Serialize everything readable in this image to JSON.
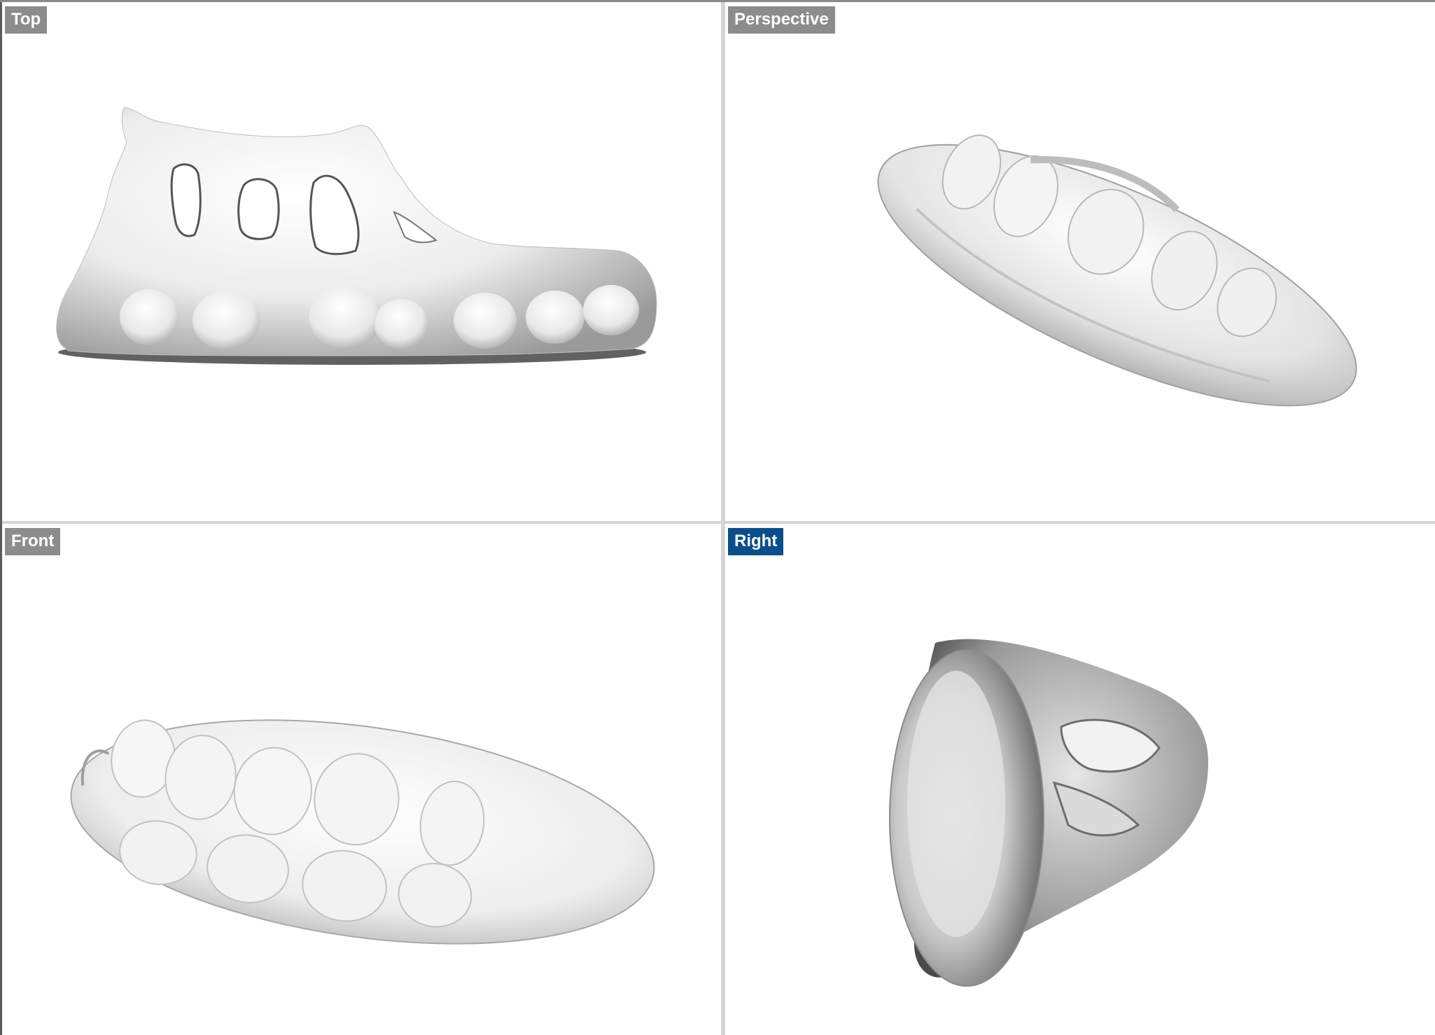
{
  "colors": {
    "label_bg": "#8c8c8c",
    "label_active_bg": "#0b4e8c",
    "viewport_bg": "#ffffff",
    "separator": "#d4d4d4"
  },
  "viewports": [
    {
      "id": "top",
      "label": "Top",
      "active": false
    },
    {
      "id": "perspective",
      "label": "Perspective",
      "active": false
    },
    {
      "id": "front",
      "label": "Front",
      "active": false
    },
    {
      "id": "right",
      "label": "Right",
      "active": true
    }
  ]
}
